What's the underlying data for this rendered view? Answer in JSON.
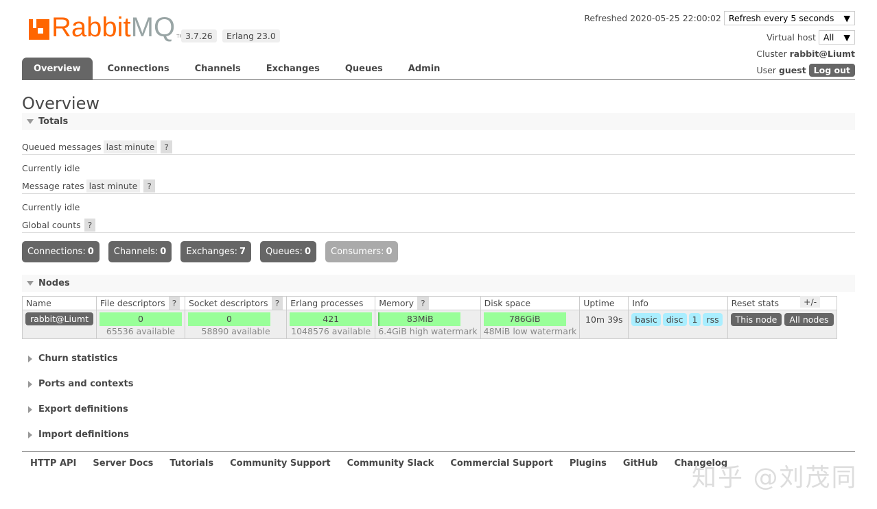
{
  "header": {
    "logo_text_a": "Rabbit",
    "logo_text_b": "MQ",
    "version": "3.7.26",
    "erlang": "Erlang 23.0",
    "refreshed_label": "Refreshed 2020-05-25 22:00:02",
    "refresh_select": "Refresh every 5 seconds",
    "vhost_label": "Virtual host",
    "vhost_select": "All",
    "cluster_label": "Cluster",
    "cluster_name": "rabbit@Liumt",
    "user_label": "User",
    "user_name": "guest",
    "logout": "Log out"
  },
  "tabs": [
    "Overview",
    "Connections",
    "Channels",
    "Exchanges",
    "Queues",
    "Admin"
  ],
  "page_title": "Overview",
  "totals": {
    "title": "Totals",
    "queued_label": "Queued messages",
    "queued_range": "last minute",
    "help": "?",
    "idle1": "Currently idle",
    "rates_label": "Message rates",
    "rates_range": "last minute",
    "idle2": "Currently idle",
    "global_label": "Global counts",
    "counts": [
      {
        "label": "Connections:",
        "value": "0"
      },
      {
        "label": "Channels:",
        "value": "0"
      },
      {
        "label": "Exchanges:",
        "value": "7"
      },
      {
        "label": "Queues:",
        "value": "0"
      },
      {
        "label": "Consumers:",
        "value": "0"
      }
    ]
  },
  "nodes": {
    "title": "Nodes",
    "headers": [
      "Name",
      "File descriptors",
      "Socket descriptors",
      "Erlang processes",
      "Memory",
      "Disk space",
      "Uptime",
      "Info",
      "Reset stats"
    ],
    "plusminus": "+/-",
    "row": {
      "name": "rabbit@Liumt",
      "fd": "0",
      "fd_avail": "65536 available",
      "sd": "0",
      "sd_avail": "58890 available",
      "ep": "421",
      "ep_avail": "1048576 available",
      "mem": "83MiB",
      "mem_sub": "6.4GiB high watermark",
      "disk": "786GiB",
      "disk_sub": "48MiB low watermark",
      "uptime": "10m 39s",
      "info": [
        "basic",
        "disc",
        "1",
        "rss"
      ],
      "reset_this": "This node",
      "reset_all": "All nodes"
    }
  },
  "sections": [
    "Churn statistics",
    "Ports and contexts",
    "Export definitions",
    "Import definitions"
  ],
  "footer": [
    "HTTP API",
    "Server Docs",
    "Tutorials",
    "Community Support",
    "Community Slack",
    "Commercial Support",
    "Plugins",
    "GitHub",
    "Changelog"
  ],
  "watermark": "知乎 @刘茂同"
}
